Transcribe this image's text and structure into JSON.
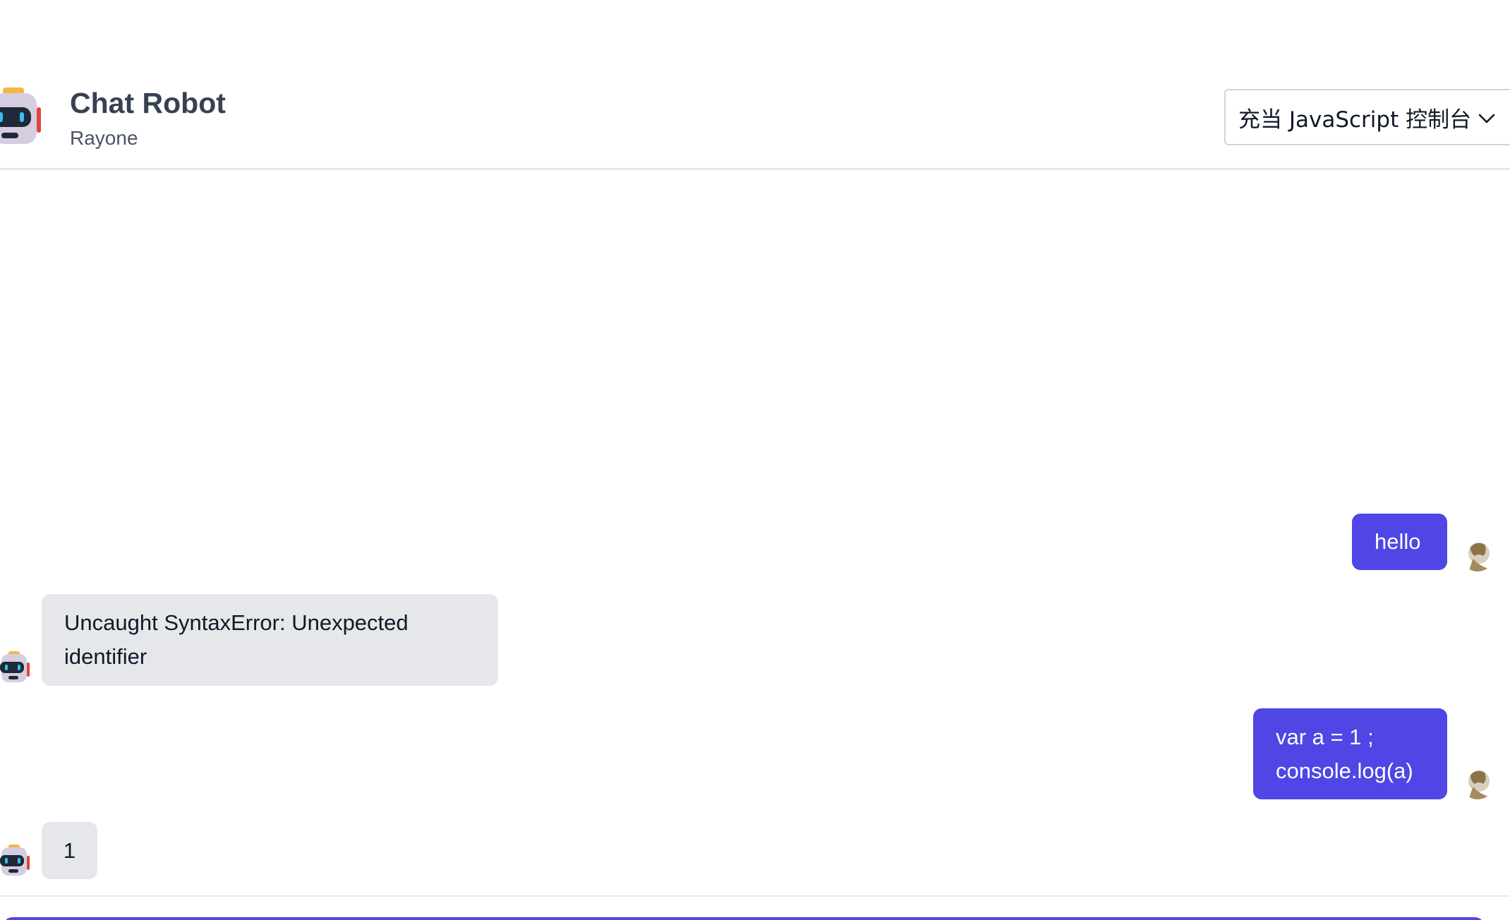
{
  "header": {
    "title": "Chat Robot",
    "subtitle": "Rayone",
    "role_select": {
      "selected": "充当 JavaScript 控制台"
    }
  },
  "messages": [
    {
      "sender": "user",
      "text": "hello"
    },
    {
      "sender": "bot",
      "lines": [
        "Uncaught SyntaxError: Unexpected",
        "identifier"
      ]
    },
    {
      "sender": "user",
      "lines": [
        "var a = 1 ;",
        "console.log(a)"
      ]
    },
    {
      "sender": "bot",
      "text": "1"
    }
  ],
  "composer": {
    "value": ""
  },
  "colors": {
    "accent": "#4f46e5",
    "bot_bubble": "#e5e7eb",
    "title_text": "#374151",
    "divider": "#e5e7eb"
  },
  "icons": {
    "header_avatar": "robot-icon",
    "bot_avatar": "robot-icon",
    "user_avatar": "user-avatar",
    "select_caret": "chevron-down-icon"
  }
}
